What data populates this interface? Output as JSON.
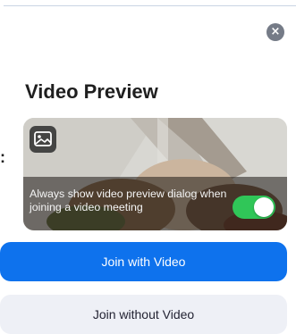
{
  "dialog": {
    "title": "Video Preview",
    "partial_text": ":",
    "close_symbol": "×",
    "preview": {
      "image_icon": "image-icon",
      "always_show_label": "Always show video preview dialog when joining a video meeting",
      "always_show_enabled": true
    },
    "join_with_video_label": "Join with Video",
    "join_without_video_label": "Join without Video"
  },
  "colors": {
    "primary": "#0e72ed",
    "toggle_on": "#30c658",
    "secondary_button": "#eef0f6"
  }
}
